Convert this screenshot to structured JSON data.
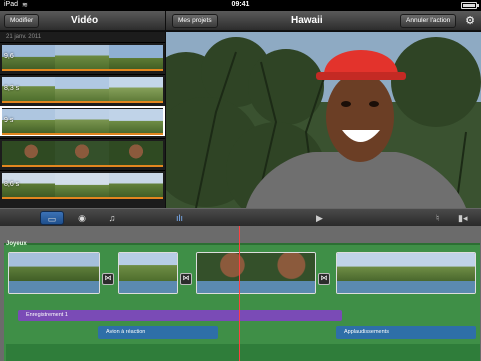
{
  "status": {
    "carrier": "iPad",
    "time": "09:41"
  },
  "left_nav": {
    "edit_label": "Modifier",
    "title": "Vidéo"
  },
  "right_nav": {
    "projects_label": "Mes projets",
    "title": "Hawaii",
    "undo_label": "Annuler l'action"
  },
  "browser": {
    "date": "21 janv. 2011",
    "clips": [
      {
        "duration": "9,6"
      },
      {
        "duration": "8,3 s"
      },
      {
        "duration": "9 s"
      },
      {
        "duration": ""
      },
      {
        "duration": "8,6 s"
      }
    ]
  },
  "timeline": {
    "theme_label": "Joyeux",
    "recording_label": "Enregistrement 1",
    "sfx_1_label": "Avion à réaction",
    "sfx_2_label": "Applaudissements"
  },
  "icons": {
    "gear": "⚙",
    "camera": "⬤",
    "music": "♫",
    "play": "▶",
    "mic": "🎙",
    "cam_capture": "▮"
  },
  "colors": {
    "accent_blue": "#2e6fa8",
    "theme_green": "#3f8f47",
    "recording_purple": "#7a4bb6",
    "playhead_red": "#ff4040",
    "used_orange": "#e2861f"
  }
}
